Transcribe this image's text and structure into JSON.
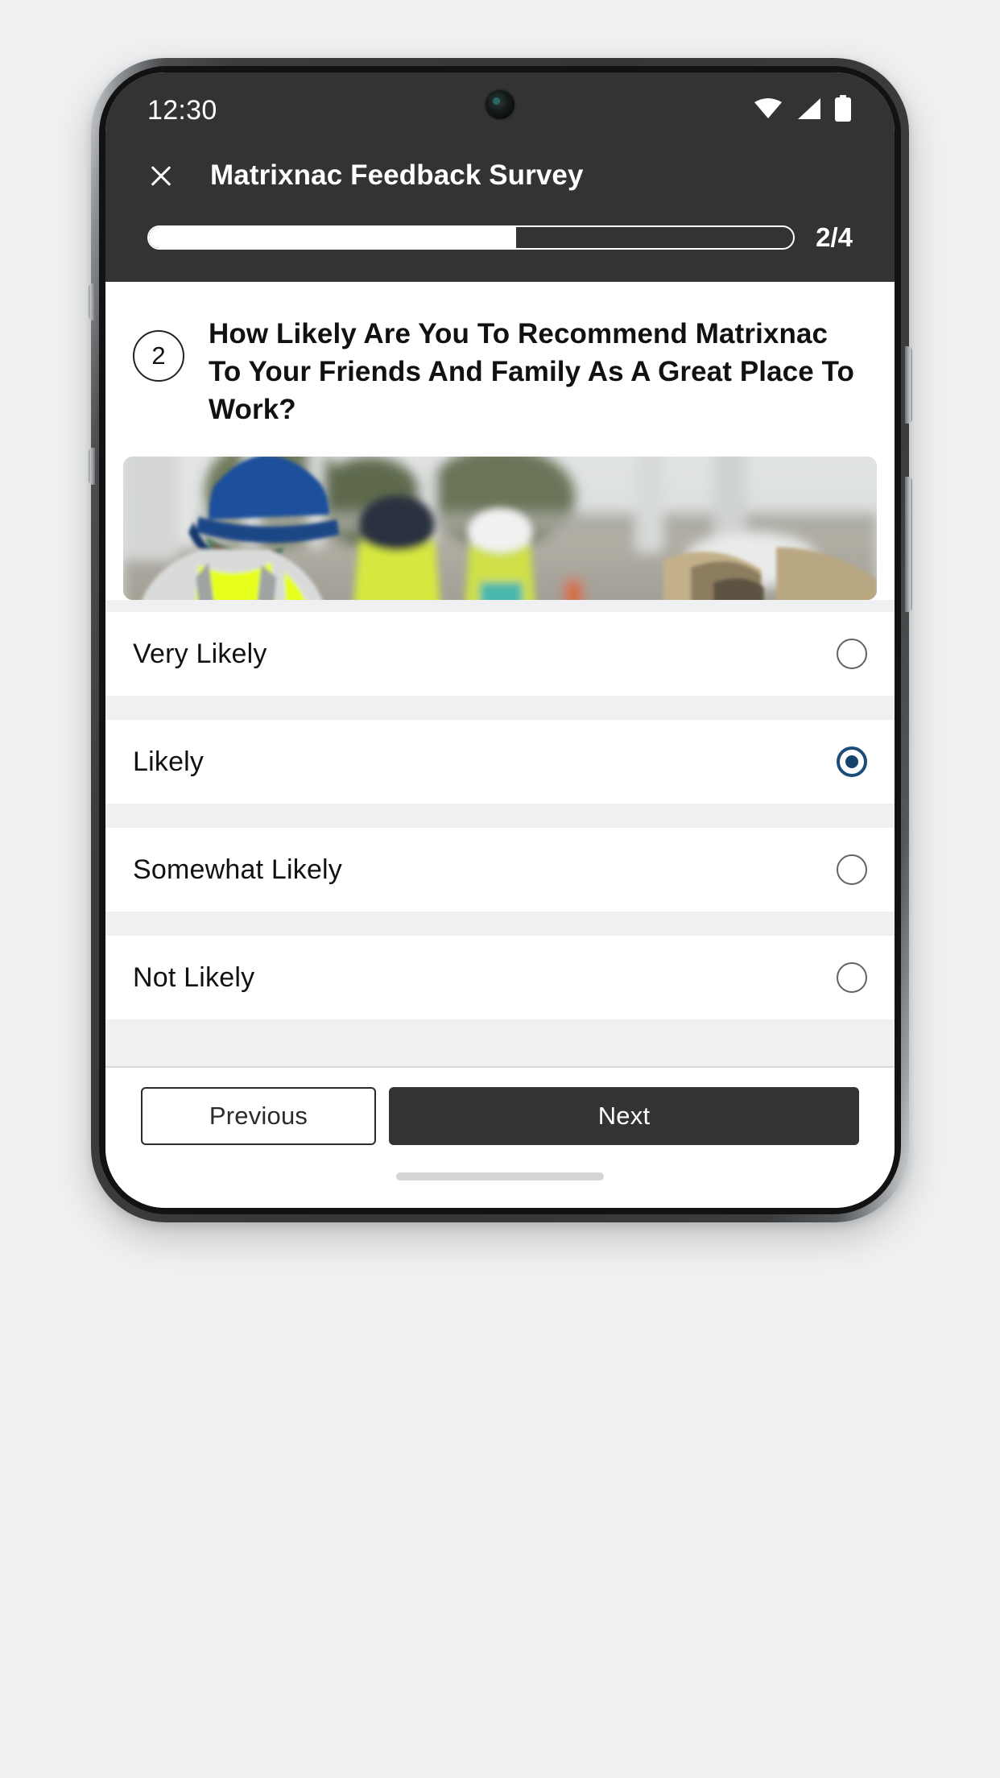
{
  "statusbar": {
    "time": "12:30",
    "icons": [
      "wifi-icon",
      "cellular-signal-icon",
      "battery-icon"
    ]
  },
  "header": {
    "close_icon": "close-icon",
    "title": "Matrixnac Feedback Survey"
  },
  "progress": {
    "current_step": 2,
    "total_steps": 4,
    "label": "2/4",
    "percent": 57
  },
  "question": {
    "number": "2",
    "text": "How Likely Are You To Recommend Matrixnac To Your Friends And Family As A Great Place To Work?",
    "image_alt": "construction-workers-photo"
  },
  "options": [
    {
      "label": "Very Likely",
      "selected": false
    },
    {
      "label": "Likely",
      "selected": true
    },
    {
      "label": "Somewhat Likely",
      "selected": false
    },
    {
      "label": "Not Likely",
      "selected": false
    }
  ],
  "footer": {
    "previous_label": "Previous",
    "next_label": "Next"
  },
  "colors": {
    "header_bg": "#333333",
    "page_bg": "#eef0f2",
    "selected_radio": "#17436b",
    "radio_border": "#5e6366",
    "next_button_bg": "#333333"
  }
}
